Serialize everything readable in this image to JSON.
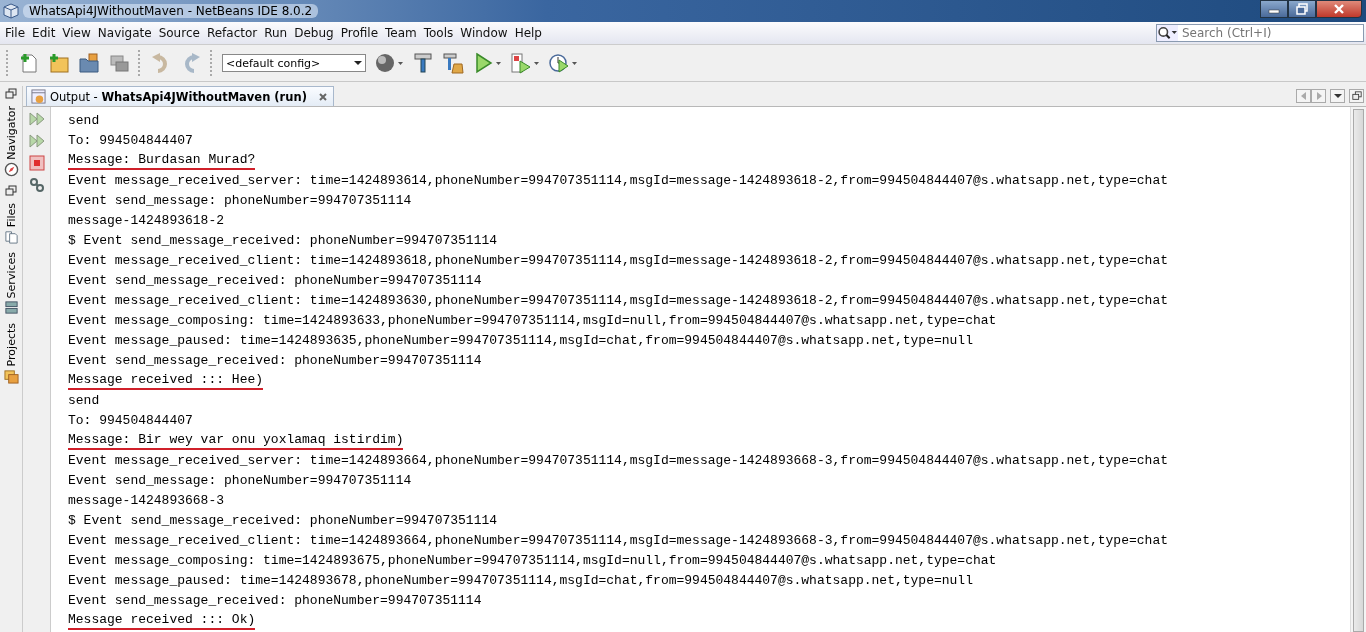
{
  "window": {
    "title": "WhatsApi4JWithoutMaven - NetBeans IDE 8.0.2"
  },
  "menu": [
    "File",
    "Edit",
    "View",
    "Navigate",
    "Source",
    "Refactor",
    "Run",
    "Debug",
    "Profile",
    "Team",
    "Tools",
    "Window",
    "Help"
  ],
  "search": {
    "placeholder": "Search (Ctrl+I)"
  },
  "toolbar": {
    "config": "<default config>"
  },
  "side_tabs": [
    {
      "label": "Navigator",
      "kind": "navigator"
    },
    {
      "label": "Files",
      "kind": "files"
    },
    {
      "label": "Services",
      "kind": "services"
    },
    {
      "label": "Projects",
      "kind": "projects"
    }
  ],
  "output_tab": {
    "title": "Output - **WhatsApi4JWithoutMaven (run)**"
  },
  "lines": [
    {
      "text": "send",
      "underlined": false
    },
    {
      "text": "To: 994504844407",
      "underlined": false
    },
    {
      "text": "Message: Burdasan Murad?",
      "underlined": true
    },
    {
      "text": "Event message_received_server: time=1424893614,phoneNumber=994707351114,msgId=message-1424893618-2,from=994504844407@s.whatsapp.net,type=chat",
      "underlined": false
    },
    {
      "text": "Event send_message: phoneNumber=994707351114",
      "underlined": false
    },
    {
      "text": "message-1424893618-2",
      "underlined": false
    },
    {
      "text": "$ Event send_message_received: phoneNumber=994707351114",
      "underlined": false
    },
    {
      "text": "Event message_received_client: time=1424893618,phoneNumber=994707351114,msgId=message-1424893618-2,from=994504844407@s.whatsapp.net,type=chat",
      "underlined": false
    },
    {
      "text": "Event send_message_received: phoneNumber=994707351114",
      "underlined": false
    },
    {
      "text": "Event message_received_client: time=1424893630,phoneNumber=994707351114,msgId=message-1424893618-2,from=994504844407@s.whatsapp.net,type=chat",
      "underlined": false
    },
    {
      "text": "Event message_composing: time=1424893633,phoneNumber=994707351114,msgId=null,from=994504844407@s.whatsapp.net,type=chat",
      "underlined": false
    },
    {
      "text": "Event message_paused: time=1424893635,phoneNumber=994707351114,msgId=chat,from=994504844407@s.whatsapp.net,type=null",
      "underlined": false
    },
    {
      "text": "Event send_message_received: phoneNumber=994707351114",
      "underlined": false
    },
    {
      "text": "Message received ::: Hee)",
      "underlined": true
    },
    {
      "text": "send",
      "underlined": false
    },
    {
      "text": "To: 994504844407",
      "underlined": false
    },
    {
      "text": "Message: Bir wey var onu yoxlamaq istirdim)",
      "underlined": true
    },
    {
      "text": "Event message_received_server: time=1424893664,phoneNumber=994707351114,msgId=message-1424893668-3,from=994504844407@s.whatsapp.net,type=chat",
      "underlined": false
    },
    {
      "text": "Event send_message: phoneNumber=994707351114",
      "underlined": false
    },
    {
      "text": "message-1424893668-3",
      "underlined": false
    },
    {
      "text": "$ Event send_message_received: phoneNumber=994707351114",
      "underlined": false
    },
    {
      "text": "Event message_received_client: time=1424893664,phoneNumber=994707351114,msgId=message-1424893668-3,from=994504844407@s.whatsapp.net,type=chat",
      "underlined": false
    },
    {
      "text": "Event message_composing: time=1424893675,phoneNumber=994707351114,msgId=null,from=994504844407@s.whatsapp.net,type=chat",
      "underlined": false
    },
    {
      "text": "Event message_paused: time=1424893678,phoneNumber=994707351114,msgId=chat,from=994504844407@s.whatsapp.net,type=null",
      "underlined": false
    },
    {
      "text": "Event send_message_received: phoneNumber=994707351114",
      "underlined": false
    },
    {
      "text": "Message received ::: Ok)",
      "underlined": true
    }
  ]
}
